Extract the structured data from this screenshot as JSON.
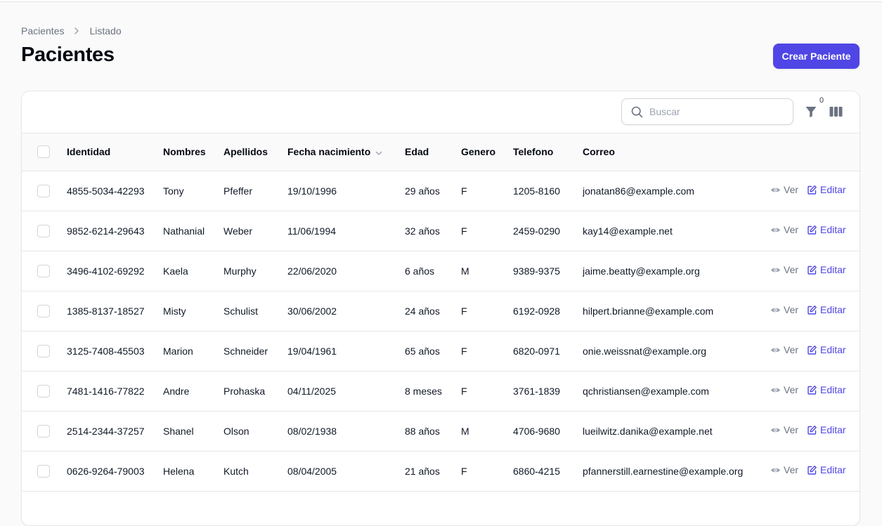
{
  "breadcrumb": {
    "parent": "Pacientes",
    "current": "Listado"
  },
  "page": {
    "title": "Pacientes",
    "create_button": "Crear Paciente"
  },
  "toolbar": {
    "search_placeholder": "Buscar",
    "filter_count": "0"
  },
  "table": {
    "columns": [
      "Identidad",
      "Nombres",
      "Apellidos",
      "Fecha nacimiento",
      "Edad",
      "Genero",
      "Telefono",
      "Correo"
    ],
    "row_actions": {
      "view": "Ver",
      "edit": "Editar"
    },
    "rows": [
      [
        "4855-5034-42293",
        "Tony",
        "Pfeffer",
        "19/10/1996",
        "29 años",
        "F",
        "1205-8160",
        "jonatan86@example.com"
      ],
      [
        "9852-6214-29643",
        "Nathanial",
        "Weber",
        "11/06/1994",
        "32 años",
        "F",
        "2459-0290",
        "kay14@example.net"
      ],
      [
        "3496-4102-69292",
        "Kaela",
        "Murphy",
        "22/06/2020",
        "6 años",
        "M",
        "9389-9375",
        "jaime.beatty@example.org"
      ],
      [
        "1385-8137-18527",
        "Misty",
        "Schulist",
        "30/06/2002",
        "24 años",
        "F",
        "6192-0928",
        "hilpert.brianne@example.com"
      ],
      [
        "3125-7408-45503",
        "Marion",
        "Schneider",
        "19/04/1961",
        "65 años",
        "F",
        "6820-0971",
        "onie.weissnat@example.org"
      ],
      [
        "7481-1416-77822",
        "Andre",
        "Prohaska",
        "04/11/2025",
        "8 meses",
        "F",
        "3761-1839",
        "qchristiansen@example.com"
      ],
      [
        "2514-2344-37257",
        "Shanel",
        "Olson",
        "08/02/1938",
        "88 años",
        "M",
        "4706-9680",
        "lueilwitz.danika@example.net"
      ],
      [
        "0626-9264-79003",
        "Helena",
        "Kutch",
        "08/04/2005",
        "21 años",
        "F",
        "6860-4215",
        "pfannerstill.earnestine@example.org"
      ]
    ]
  },
  "colors": {
    "accent": "#4f46e5",
    "border": "#e5e7eb",
    "muted": "#6b7280",
    "background": "#fafafa"
  },
  "icons": {
    "breadcrumb_separator": "chevron-right-icon",
    "search": "search-icon",
    "filter": "funnel-icon",
    "columns": "columns-icon",
    "sort": "chevron-down-icon",
    "view": "eye-icon",
    "edit": "pencil-square-icon"
  }
}
